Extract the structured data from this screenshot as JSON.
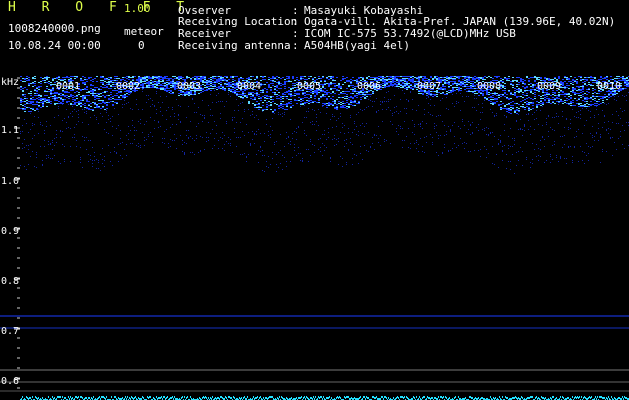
{
  "app": {
    "name": "H R O F F T",
    "version": "1.00"
  },
  "file": {
    "name": "1008240000.png",
    "datetime": "10.08.24 00:00"
  },
  "meteor": {
    "label": "meteor",
    "count": "0"
  },
  "info": [
    {
      "key": "Ovserver",
      "sep": ":",
      "value": "Masayuki Kobayashi"
    },
    {
      "key": "Receiving Location",
      "sep": ":",
      "value": "Ogata-vill. Akita-Pref. JAPAN (139.96E, 40.02N)"
    },
    {
      "key": "Receiver",
      "sep": ":",
      "value": "ICOM IC-575 53.7492(@LCD)MHz USB"
    },
    {
      "key": "Receiving antenna",
      "sep": ":",
      "value": "A504HB(yagi 4el)"
    }
  ],
  "spectrogram": {
    "unit": "kHz",
    "y_ticks": [
      "1.1",
      "1.0",
      "0.9",
      "0.8",
      "0.7",
      "0.6"
    ],
    "time_labels": [
      "0001",
      "0002",
      "0003",
      "0004",
      "0005",
      "0006",
      "0007",
      "0008",
      "0009",
      "0010"
    ],
    "colors": {
      "background": "#000000",
      "noise": "#1a3cff",
      "bright": "#5fd8ff",
      "axis": "#ffffff",
      "baseline": "#22e0ff"
    }
  }
}
